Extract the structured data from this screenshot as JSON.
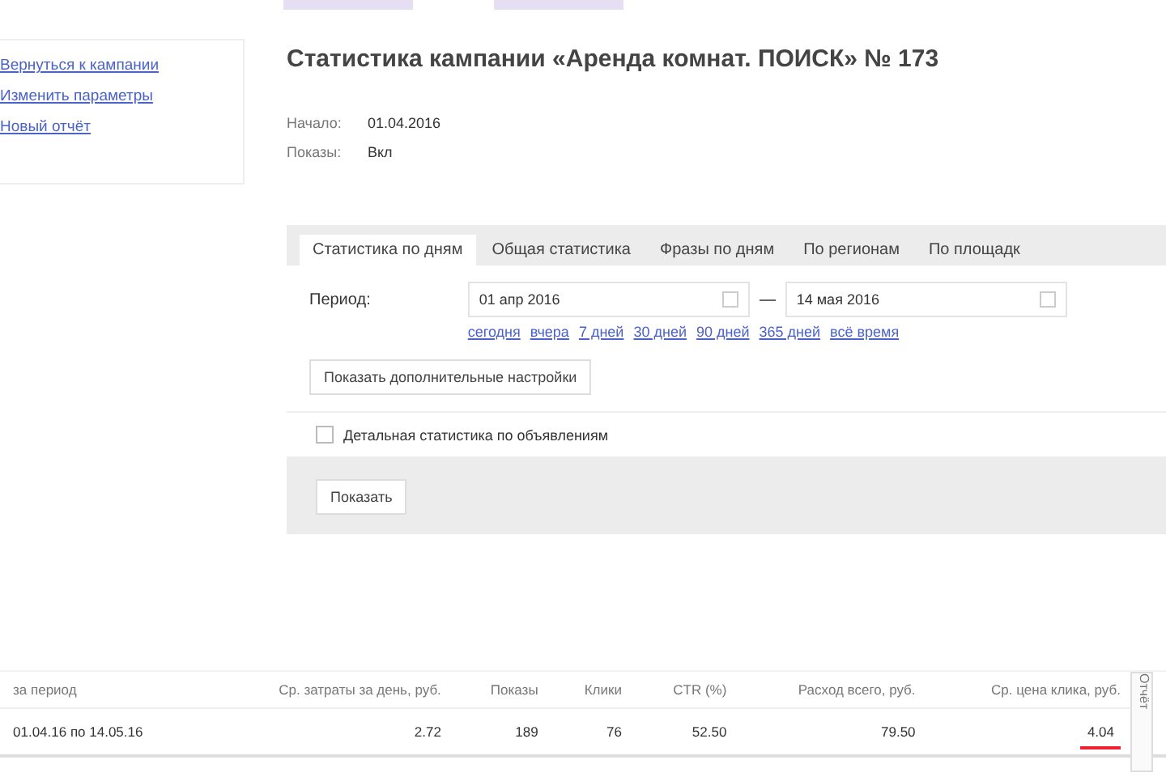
{
  "sidebar": {
    "links": [
      "Вернуться к кампании",
      "Изменить параметры",
      "Новый отчёт"
    ]
  },
  "title": "Статистика кампании «Аренда комнат. ПОИСК» № 173",
  "info": [
    {
      "label": "Начало:",
      "value": "01.04.2016"
    },
    {
      "label": "Показы:",
      "value": "Вкл"
    }
  ],
  "tabs": [
    {
      "label": "Статистика по дням",
      "selected": true
    },
    {
      "label": "Общая статистика",
      "selected": false
    },
    {
      "label": "Фразы по дням",
      "selected": false
    },
    {
      "label": "По регионам",
      "selected": false
    },
    {
      "label": "По площадк",
      "selected": false
    }
  ],
  "period": {
    "label": "Период:",
    "from": "01 апр 2016",
    "to": "14 мая 2016",
    "quick_links": [
      "сегодня",
      "вчера",
      "7 дней",
      "30 дней",
      "90 дней",
      "365 дней",
      "всё время"
    ]
  },
  "settings_button": "Показать дополнительные настройки",
  "detail_checkbox": {
    "label": "Детальная статистика по объявлениям",
    "checked": false
  },
  "show_button": "Показать",
  "table": {
    "columns": [
      "за период",
      "Ср. затраты за день, руб.",
      "Показы",
      "Клики",
      "CTR (%)",
      "Расход всего, руб.",
      "Ср. цена клика, руб."
    ],
    "rows": [
      [
        "01.04.16 по 14.05.16",
        "2.72",
        "189",
        "76",
        "52.50",
        "79.50",
        "4.04"
      ]
    ]
  },
  "side_tab": "Отчёт"
}
